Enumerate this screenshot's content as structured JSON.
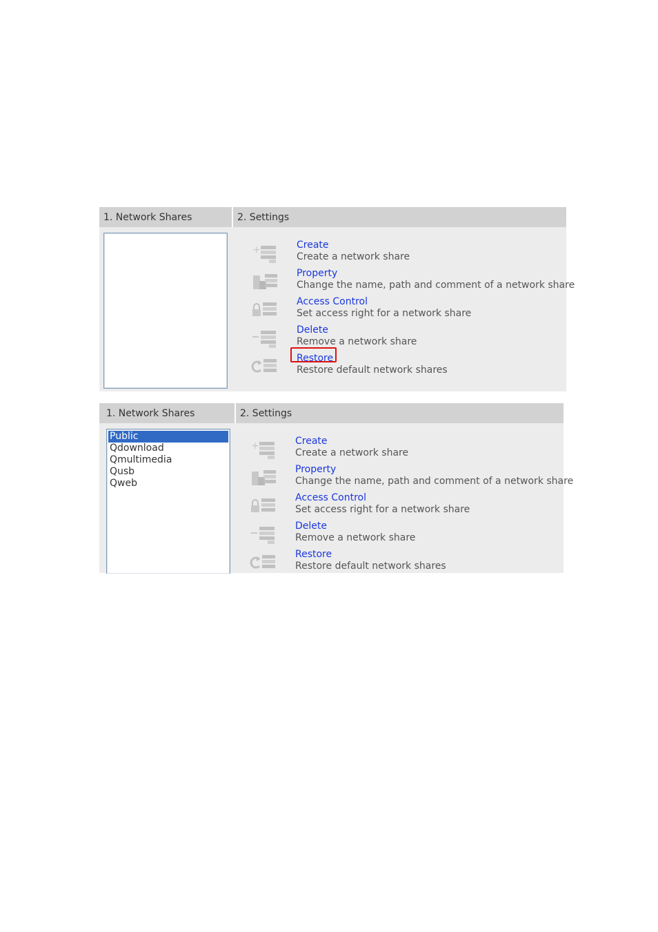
{
  "panel1": {
    "header": {
      "shares": "1. Network Shares",
      "settings": "2. Settings"
    },
    "share_list": [],
    "actions": [
      {
        "title": "Create",
        "desc": "Create a network share",
        "icon": "add-share-icon"
      },
      {
        "title": "Property",
        "desc": "Change the name, path and comment of a network share",
        "icon": "property-icon"
      },
      {
        "title": "Access Control",
        "desc": "Set access right for a network share",
        "icon": "lock-icon"
      },
      {
        "title": "Delete",
        "desc": "Remove a network share",
        "icon": "remove-share-icon"
      },
      {
        "title": "Restore",
        "desc": "Restore default network shares",
        "icon": "restore-icon"
      }
    ],
    "highlighted_action": "Restore"
  },
  "panel2": {
    "header": {
      "shares": "1. Network Shares",
      "settings": "2. Settings"
    },
    "share_list": [
      "Public",
      "Qdownload",
      "Qmultimedia",
      "Qusb",
      "Qweb"
    ],
    "selected_share": "Public",
    "actions": [
      {
        "title": "Create",
        "desc": "Create a network share",
        "icon": "add-share-icon"
      },
      {
        "title": "Property",
        "desc": "Change the name, path and comment of a network share",
        "icon": "property-icon"
      },
      {
        "title": "Access Control",
        "desc": "Set access right for a network share",
        "icon": "lock-icon"
      },
      {
        "title": "Delete",
        "desc": "Remove a network share",
        "icon": "remove-share-icon"
      },
      {
        "title": "Restore",
        "desc": "Restore default network shares",
        "icon": "restore-icon"
      }
    ]
  },
  "colors": {
    "link": "#1a37dd",
    "selection": "#316ac5",
    "highlight": "#e01010",
    "header_bg": "#d2d2d2",
    "panel_bg": "#ececec"
  }
}
